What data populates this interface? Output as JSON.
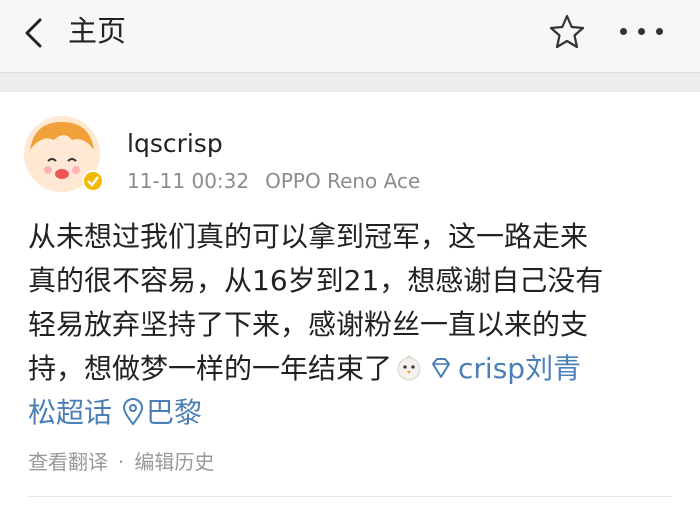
{
  "header": {
    "back_icon": "chevron-left-icon",
    "title": "主页",
    "favorite_icon": "star-outline-icon",
    "more_icon": "more-dots-icon"
  },
  "post": {
    "username": "lqscrisp",
    "timestamp": "11-11 00:32",
    "device": "OPPO Reno Ace",
    "verified_badge_color": "#f5b800",
    "text_lines": [
      "从未想过我们真的可以拿到冠军，这一路走来",
      "真的很不容易，从16岁到21，想感谢自己没有",
      "轻易放弃坚持了下来，感谢粉丝一直以来的支",
      "持，想做梦一样的一年结束了"
    ],
    "emoji": "chick-emoji",
    "topic_link": "crisp刘青",
    "topic_link_cont": "松超话",
    "location": "巴黎",
    "link_color": "#4a7fb8"
  },
  "footer": {
    "translate": "查看翻译",
    "separator": "·",
    "edit_history": "编辑历史"
  }
}
